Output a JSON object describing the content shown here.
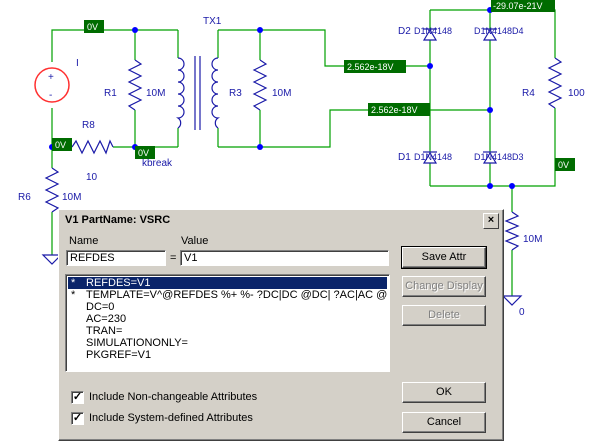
{
  "schematic": {
    "node_tags": {
      "top_left": "0V",
      "top_right": "-29.07e-21V",
      "mid_upper": "2.562e-18V",
      "mid_lower": "2.562e-18V",
      "left_bottom": "0V",
      "r1_bottom": "0V",
      "r4_bottom": "0V"
    },
    "labels": {
      "source": "I",
      "tx": "TX1",
      "r1": "R1",
      "r1_val": "10M",
      "r3": "R3",
      "r3_val": "10M",
      "r8": "R8",
      "r8_val": "10",
      "kbreak": "kbreak",
      "r6": "R6",
      "r6_val": "10M",
      "r4": "R4",
      "r4_val": "100",
      "r4_gnd_val": "10M",
      "gnd_zero": "0",
      "d1": "D1",
      "d2": "D2",
      "d3": "D1N4148D3",
      "d3_alt": "D1N4148",
      "d4": "D1N4148D4",
      "d4_alt": "D1N4148",
      "d1_part": "D1N4148",
      "d2_part": "D1N4148",
      "plus": "+",
      "minus": "-"
    },
    "colors": {
      "wire": "#00a000",
      "component": "#1a1aa8",
      "node": "#0000ff",
      "tag_bg": "#006c00",
      "source": "#ff3030"
    }
  },
  "dialog": {
    "title": "V1   PartName: VSRC",
    "close_glyph": "×",
    "name_label": "Name",
    "value_label": "Value",
    "equals": "=",
    "name_value": "REFDES",
    "value_value": "V1",
    "attributes": [
      {
        "star": "*",
        "text": "REFDES=V1",
        "selected": true
      },
      {
        "star": "*",
        "text": "TEMPLATE=V^@REFDES %+ %- ?DC|DC @DC| ?AC|AC @AC|",
        "selected": false
      },
      {
        "star": "",
        "text": "DC=0",
        "selected": false
      },
      {
        "star": "",
        "text": "AC=230",
        "selected": false
      },
      {
        "star": "",
        "text": "TRAN=",
        "selected": false
      },
      {
        "star": "",
        "text": "SIMULATIONONLY=",
        "selected": false
      },
      {
        "star": "",
        "text": "PKGREF=V1",
        "selected": false
      }
    ],
    "buttons": {
      "save_attr": "Save Attr",
      "change_display": "Change Display",
      "delete": "Delete",
      "ok": "OK",
      "cancel": "Cancel"
    },
    "checkboxes": [
      {
        "label": "Include Non-changeable Attributes",
        "checked": true,
        "mark": "✓"
      },
      {
        "label": "Include System-defined Attributes",
        "checked": true,
        "mark": "✓"
      }
    ]
  }
}
